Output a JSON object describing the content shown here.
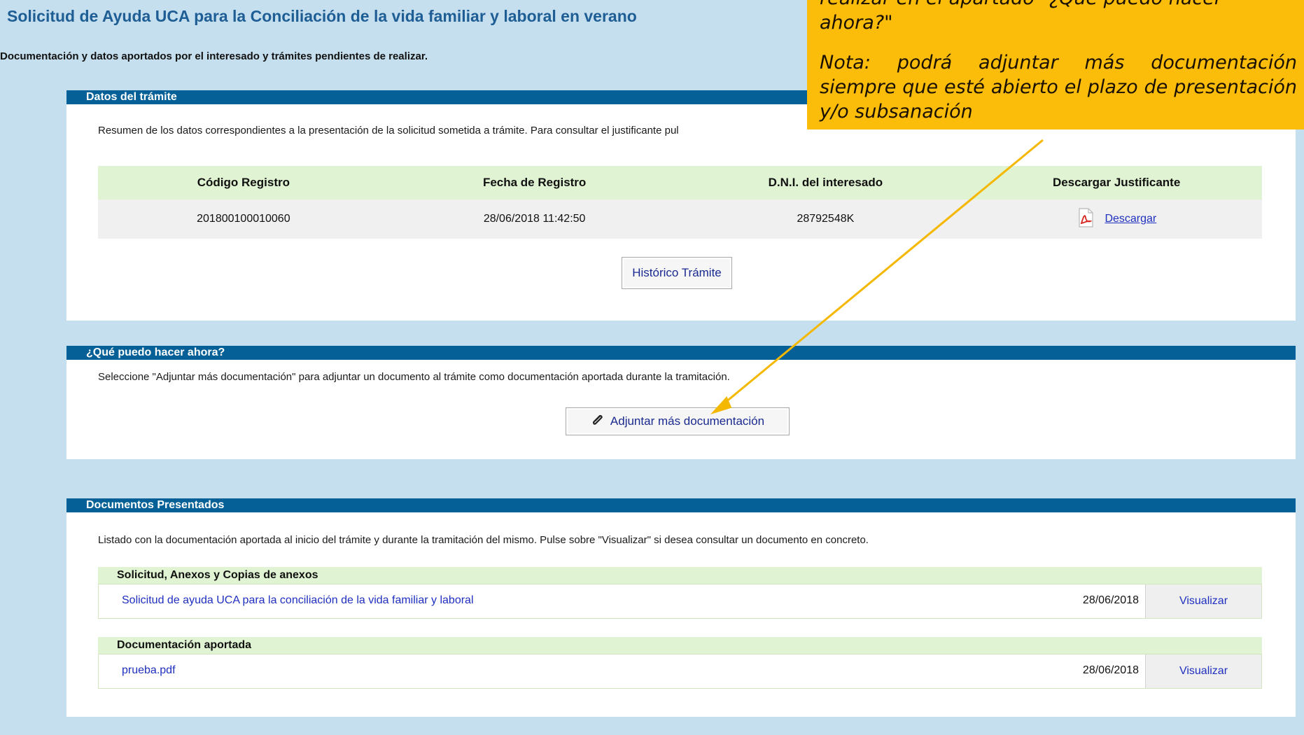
{
  "page": {
    "title": "Solicitud de Ayuda UCA para la Conciliación de la vida familiar y laboral en verano",
    "subtitle": "Documentación y datos aportados por el interesado y trámites pendientes de realizar."
  },
  "datos_tramite": {
    "header": "Datos del trámite",
    "intro": "Resumen de los datos correspondientes a la presentación de la solicitud sometida a trámite. Para consultar el justificante pul",
    "columns": [
      "Código Registro",
      "Fecha de Registro",
      "D.N.I. del interesado",
      "Descargar Justificante"
    ],
    "row": {
      "codigo": "201800100010060",
      "fecha": "28/06/2018 11:42:50",
      "dni": "28792548K",
      "descargar": "Descargar"
    },
    "historico_button": "Histórico Trámite"
  },
  "que_puedo": {
    "header": "¿Qué puedo hacer ahora?",
    "intro": "Seleccione \"Adjuntar más documentación\" para adjuntar un documento al trámite como documentación aportada durante la tramitación.",
    "adjuntar_button": "Adjuntar más documentación"
  },
  "documentos": {
    "header": "Documentos Presentados",
    "intro": "Listado con la documentación aportada al inicio del trámite y durante la tramitación del mismo. Pulse sobre \"Visualizar\" si desea consultar un documento en concreto.",
    "groups": [
      {
        "title": "Solicitud, Anexos y Copias de anexos",
        "items": [
          {
            "name": "Solicitud de ayuda UCA para la conciliación de la vida familiar y laboral",
            "date": "28/06/2018",
            "action": "Visualizar"
          }
        ]
      },
      {
        "title": "Documentación aportada",
        "items": [
          {
            "name": "prueba.pdf",
            "date": "28/06/2018",
            "action": "Visualizar"
          }
        ]
      }
    ]
  },
  "callout": {
    "top_text": "realizar en el apartado \"¿Qué puedo hacer",
    "line2": "ahora?\"",
    "nota": "Nota: podrá adjuntar más documentación siempre que esté abierto el plazo de presentación y/o subsanación",
    "color": "#fbbd0a"
  },
  "icons": {
    "pdf": "pdf-icon",
    "attach": "paperclip-icon"
  }
}
